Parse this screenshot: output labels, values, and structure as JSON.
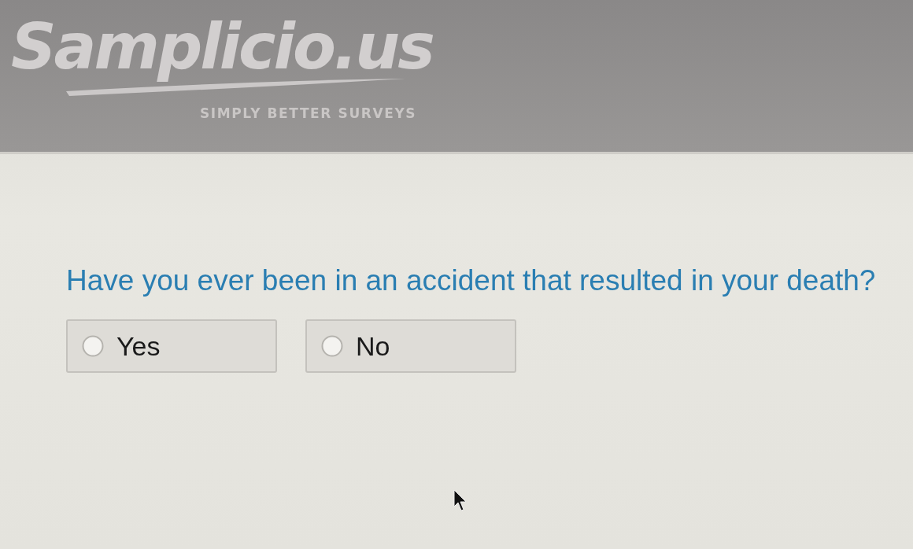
{
  "header": {
    "logo": "Samplicio.us",
    "tagline": "SIMPLY BETTER SURVEYS"
  },
  "question": {
    "text": "Have you ever been in an accident that resulted in your death?",
    "options": [
      {
        "label": "Yes",
        "selected": false
      },
      {
        "label": "No",
        "selected": false
      }
    ]
  }
}
